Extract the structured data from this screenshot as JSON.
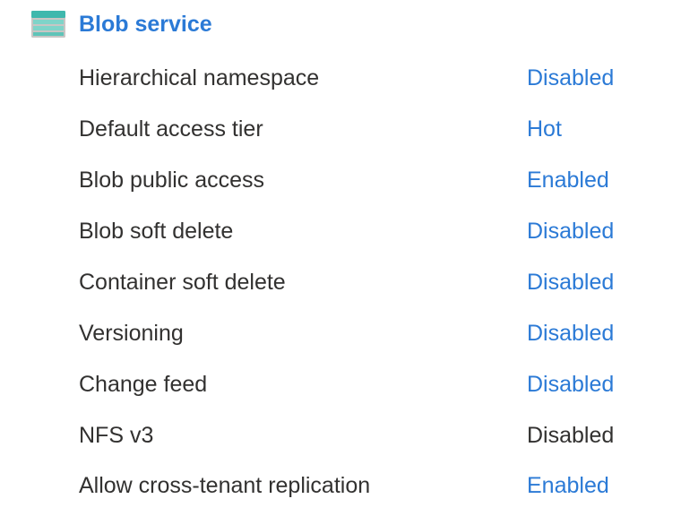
{
  "section": {
    "title": "Blob service",
    "icon": "blob-storage-icon"
  },
  "colors": {
    "link": "#2b7ad6",
    "text": "#323130"
  },
  "properties": [
    {
      "label": "Hierarchical namespace",
      "value": "Disabled",
      "is_link": true
    },
    {
      "label": "Default access tier",
      "value": "Hot",
      "is_link": true
    },
    {
      "label": "Blob public access",
      "value": "Enabled",
      "is_link": true
    },
    {
      "label": "Blob soft delete",
      "value": "Disabled",
      "is_link": true
    },
    {
      "label": "Container soft delete",
      "value": "Disabled",
      "is_link": true
    },
    {
      "label": "Versioning",
      "value": "Disabled",
      "is_link": true
    },
    {
      "label": "Change feed",
      "value": "Disabled",
      "is_link": true
    },
    {
      "label": "NFS v3",
      "value": "Disabled",
      "is_link": false
    },
    {
      "label": "Allow cross-tenant replication",
      "value": "Enabled",
      "is_link": true
    }
  ]
}
